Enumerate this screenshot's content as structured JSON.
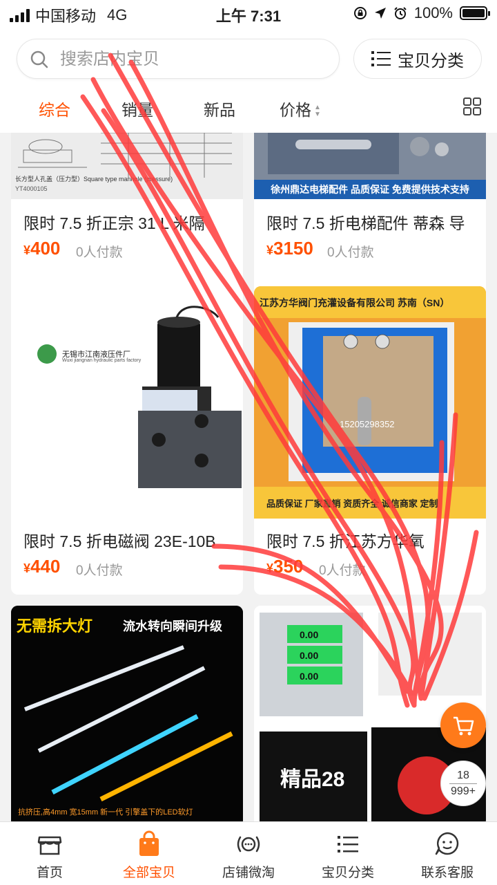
{
  "status": {
    "carrier": "中国移动",
    "network": "4G",
    "time": "上午 7:31",
    "battery": "100%",
    "battery_level": 1.0
  },
  "search": {
    "placeholder": "搜索店内宝贝"
  },
  "category_button": {
    "label": "宝贝分类"
  },
  "sort_tabs": [
    "综合",
    "销量",
    "新品",
    "价格"
  ],
  "products": [
    {
      "title": "限时 7.5 折正宗 31 L 米隔",
      "price": "400",
      "currency": "¥",
      "sold": "0人付款",
      "image_caption": "长方型人孔盖（压力型）Square type manhole (pressure)",
      "image_code": "YT4000105"
    },
    {
      "title": "限时 7.5 折电梯配件 蒂森 导",
      "price": "3150",
      "currency": "¥",
      "sold": "0人付款",
      "image_caption": "徐州鼎达电梯配件 品质保证 免费提供技术支持"
    },
    {
      "title": "限时 7.5 折电磁阀 23E-10B",
      "price": "440",
      "currency": "¥",
      "sold": "0人付款",
      "image_caption": "无锡市江南液压件厂",
      "image_caption_en": "Wuxi jiangnan hydraulic parts factory"
    },
    {
      "title": "限时 7.5 折江苏方华氧",
      "price": "350",
      "currency": "¥",
      "sold": "0人付款",
      "image_header": "江苏方华阀门充灌设备有限公司 苏南（SN）",
      "image_phone": "15205298352",
      "image_footer": "品质保证 厂家直销 资质齐全 诚信商家 定制"
    },
    {
      "image_banner": "无需拆大灯",
      "image_banner2": "流水转向瞬间升级",
      "image_footer": "抗挤压,高4mm 宽15mm 新一代 引擎盖下的LED软灯"
    },
    {
      "image_text": "精品28",
      "image_scale_values": [
        "0.00",
        "0.00",
        "0.00"
      ]
    }
  ],
  "floating": {
    "count_top": "18",
    "count_bottom": "999+"
  },
  "tabbar": [
    {
      "label": "首页",
      "icon": "store-icon"
    },
    {
      "label": "全部宝贝",
      "icon": "shopping-bag-icon"
    },
    {
      "label": "店铺微淘",
      "icon": "broadcast-icon"
    },
    {
      "label": "宝贝分类",
      "icon": "list-icon"
    },
    {
      "label": "联系客服",
      "icon": "chat-face-icon"
    }
  ],
  "colors": {
    "accent": "#ff5000",
    "scribble": "#ff3b3b"
  }
}
